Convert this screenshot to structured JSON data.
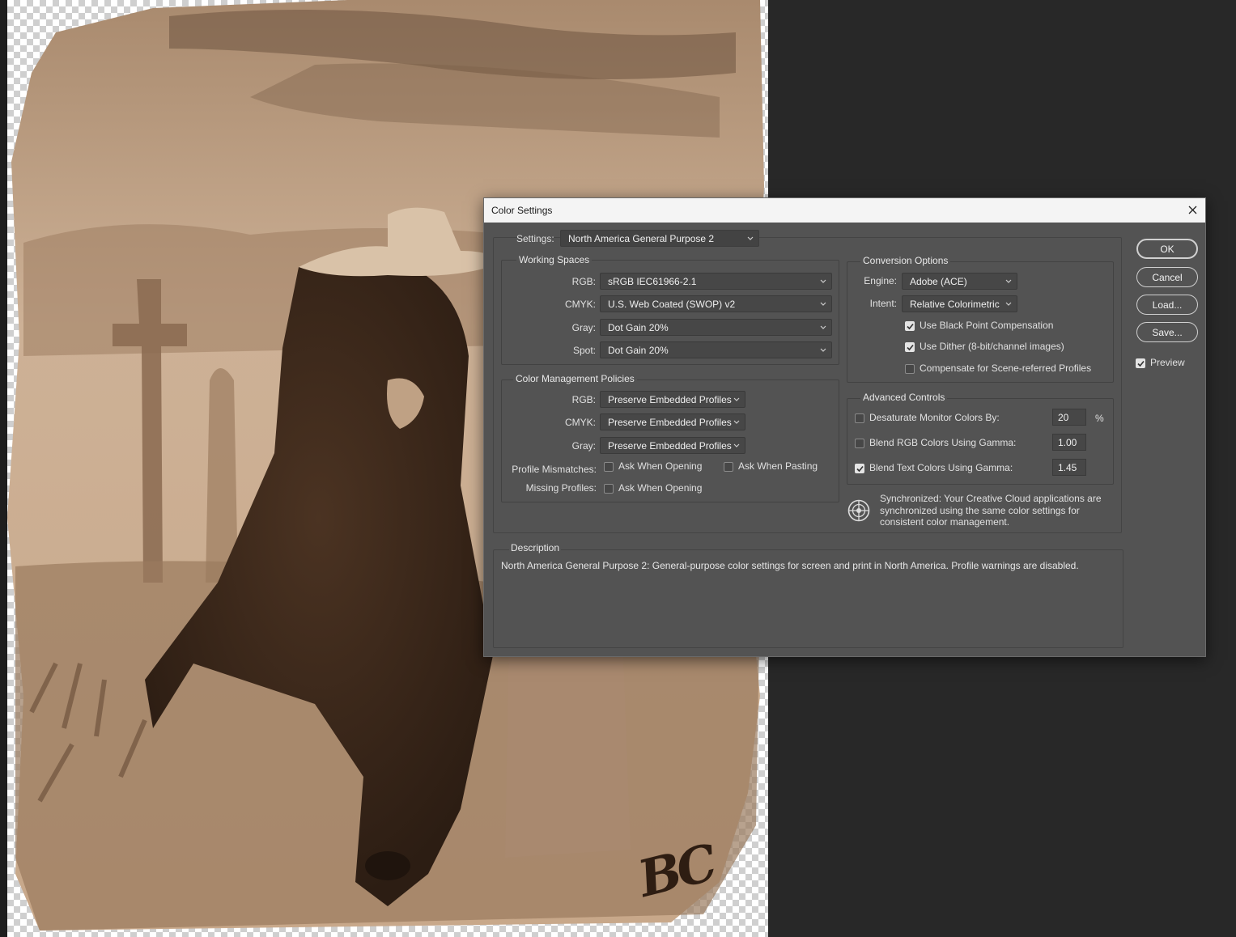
{
  "dialog": {
    "title": "Color Settings",
    "settings_label": "Settings:",
    "settings_value": "North America General Purpose 2",
    "working_spaces": {
      "title": "Working Spaces",
      "rgb_label": "RGB:",
      "rgb_value": "sRGB IEC61966-2.1",
      "cmyk_label": "CMYK:",
      "cmyk_value": "U.S. Web Coated (SWOP) v2",
      "gray_label": "Gray:",
      "gray_value": "Dot Gain 20%",
      "spot_label": "Spot:",
      "spot_value": "Dot Gain 20%"
    },
    "policies": {
      "title": "Color Management Policies",
      "rgb_label": "RGB:",
      "rgb_value": "Preserve Embedded Profiles",
      "cmyk_label": "CMYK:",
      "cmyk_value": "Preserve Embedded Profiles",
      "gray_label": "Gray:",
      "gray_value": "Preserve Embedded Profiles",
      "mismatch_label": "Profile Mismatches:",
      "ask_opening": "Ask When Opening",
      "ask_pasting": "Ask When Pasting",
      "missing_label": "Missing Profiles:",
      "missing_ask_opening": "Ask When Opening"
    },
    "conversion": {
      "title": "Conversion Options",
      "engine_label": "Engine:",
      "engine_value": "Adobe (ACE)",
      "intent_label": "Intent:",
      "intent_value": "Relative Colorimetric",
      "black_point": "Use Black Point Compensation",
      "dither": "Use Dither (8-bit/channel images)",
      "compensate": "Compensate for Scene-referred Profiles"
    },
    "advanced": {
      "title": "Advanced Controls",
      "desaturate_label": "Desaturate Monitor Colors By:",
      "desaturate_value": "20",
      "percent": "%",
      "blend_rgb_label": "Blend RGB Colors Using Gamma:",
      "blend_rgb_value": "1.00",
      "blend_text_label": "Blend Text Colors Using Gamma:",
      "blend_text_value": "1.45"
    },
    "sync_text": "Synchronized: Your Creative Cloud applications are synchronized using the same color settings for consistent color management.",
    "description": {
      "title": "Description",
      "text": "North America General Purpose 2:  General-purpose color settings for screen and print in North America. Profile warnings are disabled."
    },
    "buttons": {
      "ok": "OK",
      "cancel": "Cancel",
      "load": "Load...",
      "save": "Save..."
    },
    "preview_label": "Preview"
  },
  "states": {
    "ask_opening": false,
    "ask_pasting": false,
    "missing_ask_opening": false,
    "black_point": true,
    "dither": true,
    "compensate": false,
    "desaturate": false,
    "blend_rgb": false,
    "blend_text": true,
    "preview": true
  },
  "artwork": {
    "signature": "BC"
  },
  "colors": {
    "dialog_bg": "#535353",
    "titlebar_bg": "#f4f4f4",
    "workspace_bg": "#282828",
    "sepia_light": "#c9a98a",
    "sepia_dark": "#3a2618"
  }
}
